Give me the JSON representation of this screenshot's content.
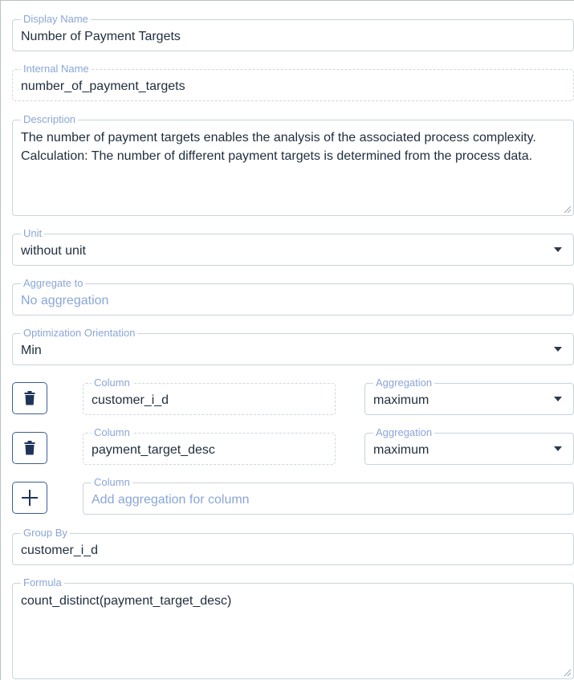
{
  "form": {
    "display_name": {
      "label": "Display Name",
      "value": "Number of Payment Targets"
    },
    "internal_name": {
      "label": "Internal Name",
      "value": "number_of_payment_targets"
    },
    "description": {
      "label": "Description",
      "value": "The number of payment targets enables the analysis of the associated process complexity. Calculation: The number of different payment targets is determined from the process data."
    },
    "unit": {
      "label": "Unit",
      "value": "without unit"
    },
    "aggregate_to": {
      "label": "Aggregate to",
      "placeholder": "No aggregation"
    },
    "optimization_orientation": {
      "label": "Optimization Orientation",
      "value": "Min"
    },
    "column_aggregations": [
      {
        "column_label": "Column",
        "column_value": "customer_i_d",
        "aggregation_label": "Aggregation",
        "aggregation_value": "maximum",
        "delete_icon": "trash-icon"
      },
      {
        "column_label": "Column",
        "column_value": "payment_target_desc",
        "aggregation_label": "Aggregation",
        "aggregation_value": "maximum",
        "delete_icon": "trash-icon"
      }
    ],
    "add_column": {
      "label": "Column",
      "placeholder": "Add aggregation for column",
      "icon": "plus-icon"
    },
    "group_by": {
      "label": "Group By",
      "value": "customer_i_d"
    },
    "formula": {
      "label": "Formula",
      "value": "count_distinct(payment_target_desc)"
    }
  },
  "colors": {
    "label": "#8aa6d6",
    "text": "#1f2d3d",
    "border": "#c9d3dd",
    "button_border": "#3a5f96",
    "icon": "#1f3558"
  }
}
